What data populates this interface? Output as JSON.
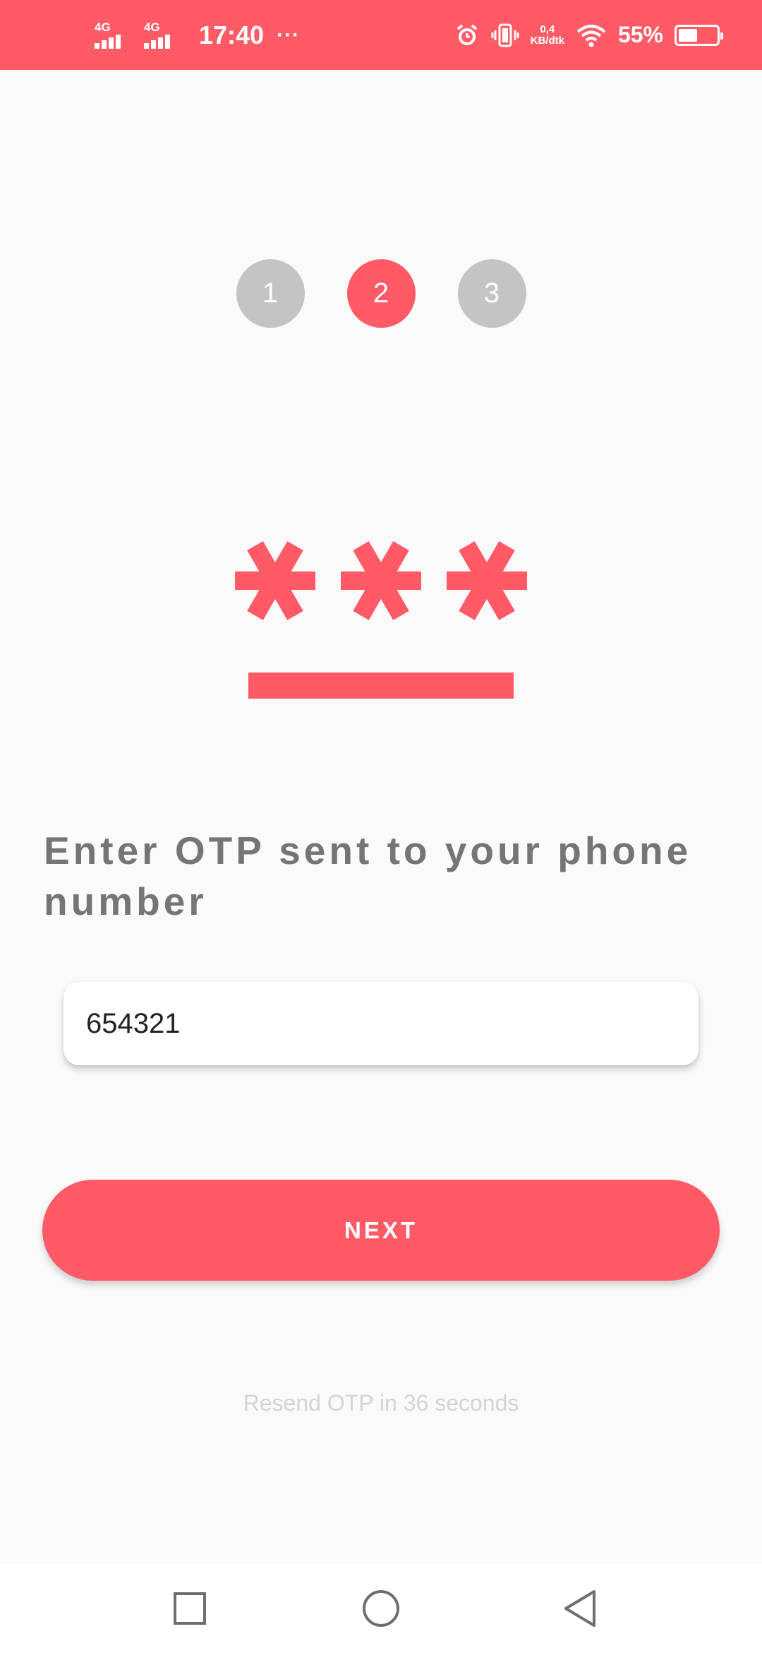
{
  "status_bar": {
    "network_1": "4G",
    "network_2": "4G",
    "time": "17:40",
    "more_indicator": "···",
    "speed_value": "0,4",
    "speed_unit": "KB/dtk",
    "battery_percent": "55%",
    "battery_level": 0.55,
    "icons": [
      "alarm-icon",
      "vibrate-icon",
      "wifi-icon",
      "battery-icon"
    ]
  },
  "stepper": {
    "steps": [
      "1",
      "2",
      "3"
    ],
    "active_index": 1
  },
  "illustration": {
    "icon": "otp-password-icon",
    "masked_text": "***"
  },
  "heading": "Enter OTP sent to your phone number",
  "otp_input": {
    "value": "654321",
    "placeholder": ""
  },
  "next_button": {
    "label": "NEXT"
  },
  "resend_text": "Resend OTP in 36 seconds",
  "nav_bar": {
    "icons": [
      "recents-square-icon",
      "home-circle-icon",
      "back-triangle-icon"
    ]
  },
  "colors": {
    "accent": "#ff5a65",
    "inactive_step": "#c4c4c4",
    "heading_text": "#757575",
    "muted_text": "#d4d4d4",
    "background": "#fafafa"
  }
}
